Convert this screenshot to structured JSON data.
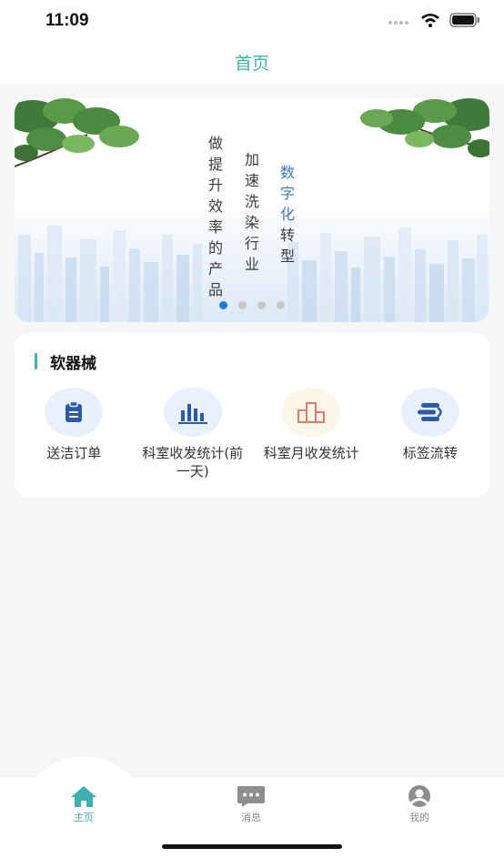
{
  "status_bar": {
    "time": "11:09"
  },
  "nav": {
    "title": "首页"
  },
  "banner": {
    "col1": "做提升效率的产品",
    "col2": "加速洗染行业",
    "col3_blue": "数字化",
    "col3_rest": "转型",
    "page_count": 4,
    "active_page": 1
  },
  "section": {
    "title": "软器械",
    "items": [
      {
        "label": "送洁订单",
        "icon": "clipboard-icon"
      },
      {
        "label": "科室收发统计(前一天)",
        "icon": "bar-chart-icon"
      },
      {
        "label": "科室月收发统计",
        "icon": "building-chart-icon"
      },
      {
        "label": "标签流转",
        "icon": "tag-flow-icon"
      }
    ]
  },
  "tabbar": {
    "home": "主页",
    "messages": "消息",
    "mine": "我的"
  },
  "colors": {
    "accent": "#3fb0b0",
    "active_dot": "#1e7be0"
  }
}
